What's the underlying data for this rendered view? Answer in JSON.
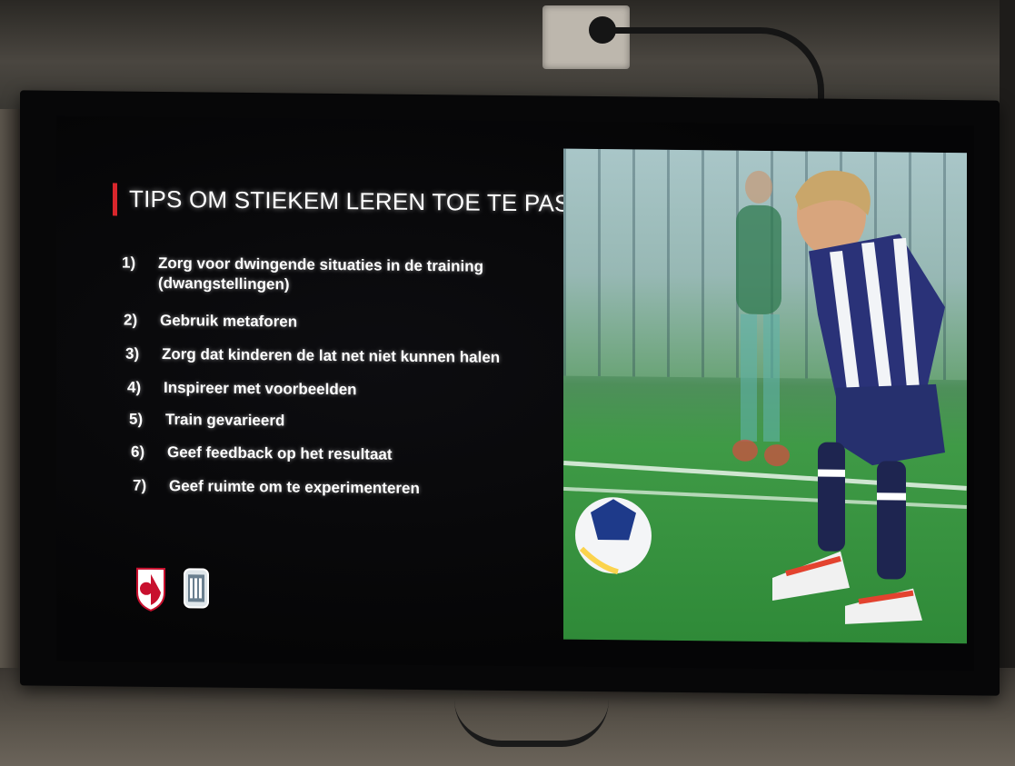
{
  "slide": {
    "title": "TIPS OM STIEKEM LEREN TOE TE PASSEN",
    "accent_color": "#d8262c",
    "tips": [
      {
        "num": "1)",
        "lines": [
          "Zorg voor dwingende situaties in de training",
          "(dwangstellingen)"
        ]
      },
      {
        "num": "2)",
        "lines": [
          "Gebruik metaforen"
        ]
      },
      {
        "num": "3)",
        "lines": [
          "Zorg dat kinderen de lat net niet kunnen halen"
        ]
      },
      {
        "num": "4)",
        "lines": [
          "Inspireer met voorbeelden"
        ]
      },
      {
        "num": "5)",
        "lines": [
          "Train gevarieerd"
        ]
      },
      {
        "num": "6)",
        "lines": [
          "Geef feedback op het resultaat"
        ]
      },
      {
        "num": "7)",
        "lines": [
          "Geef ruimte om te experimenteren"
        ]
      }
    ],
    "logos": [
      "fc-utrecht-logo",
      "club-crest-logo"
    ],
    "photo": "youth-football-player-photo"
  }
}
